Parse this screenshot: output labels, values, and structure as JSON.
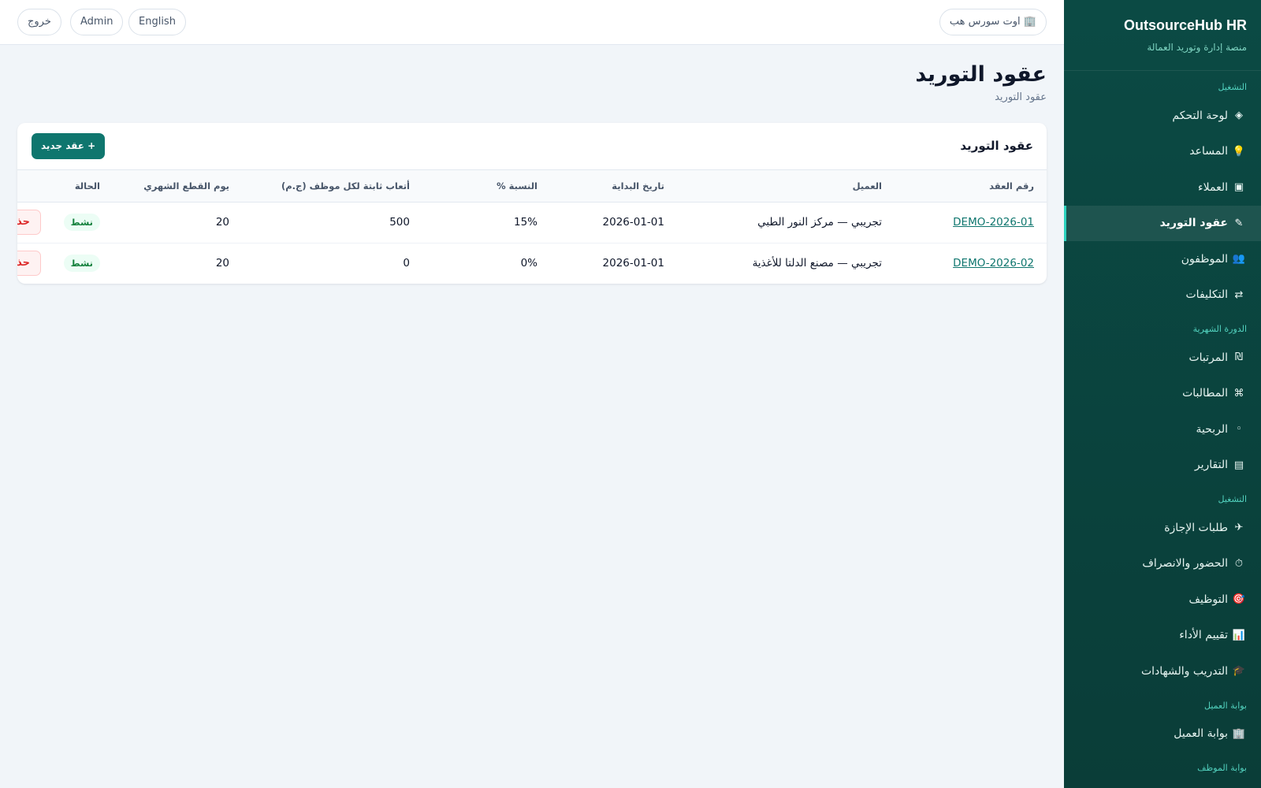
{
  "brand": {
    "title": "OutsourceHub HR",
    "subtitle": "منصة إدارة وتوريد العمالة"
  },
  "sidebar": {
    "sections": [
      {
        "label": "التشغيل",
        "items": [
          {
            "icon": "◈",
            "label": "لوحة التحكم"
          },
          {
            "icon": "💡",
            "label": "المساعد"
          },
          {
            "icon": "▣",
            "label": "العملاء"
          },
          {
            "icon": "✎",
            "label": "عقود التوريد",
            "active": true
          },
          {
            "icon": "👥",
            "label": "الموظفون"
          },
          {
            "icon": "⇄",
            "label": "التكليفات"
          }
        ]
      },
      {
        "label": "الدورة الشهرية",
        "items": [
          {
            "icon": "₪",
            "label": "المرتبات"
          },
          {
            "icon": "⌘",
            "label": "المطالبات"
          },
          {
            "icon": "◦",
            "label": "الربحية"
          },
          {
            "icon": "▤",
            "label": "التقارير"
          }
        ]
      },
      {
        "label": "التشغيل",
        "items": [
          {
            "icon": "✈",
            "label": "طلبات الإجازة"
          },
          {
            "icon": "⏱",
            "label": "الحضور والانصراف"
          },
          {
            "icon": "🎯",
            "label": "التوظيف"
          },
          {
            "icon": "📊",
            "label": "تقييم الأداء"
          },
          {
            "icon": "🎓",
            "label": "التدريب والشهادات"
          }
        ]
      },
      {
        "label": "بوابة العميل",
        "items": [
          {
            "icon": "🏢",
            "label": "بوابة العميل"
          }
        ]
      },
      {
        "label": "بوابة الموظف",
        "items": []
      }
    ]
  },
  "topbar": {
    "org_icon": "🏢",
    "org_label": "اوت سورس هب",
    "language": "English",
    "user": "Admin",
    "logout": "خروج"
  },
  "page": {
    "title": "عقود التوريد",
    "breadcrumb": "عقود التوريد"
  },
  "card": {
    "title": "عقود التوريد",
    "new_button": "+ عقد جديد"
  },
  "table": {
    "columns": [
      "رقم العقد",
      "العميل",
      "تاريخ البداية",
      "النسبة %",
      "أتعاب ثابتة لكل موظف (ج.م)",
      "يوم القطع الشهري",
      "الحالة",
      ""
    ],
    "rows": [
      {
        "contract_no": "DEMO-2026-01",
        "client": "تجريبي — مركز النور الطبي",
        "start_date": "2026-01-01",
        "percent": "15%",
        "fixed_fee": "500",
        "cutoff_day": "20",
        "status": "نشط",
        "delete": "حذف"
      },
      {
        "contract_no": "DEMO-2026-02",
        "client": "تجريبي — مصنع الدلتا للأغذية",
        "start_date": "2026-01-01",
        "percent": "0%",
        "fixed_fee": "0",
        "cutoff_day": "20",
        "status": "نشط",
        "delete": "حذف"
      }
    ]
  },
  "colors": {
    "sidebar_bg": "#0b4a44",
    "accent": "#0f766e",
    "active_indicator": "#2dd4bf",
    "status_active": "#15803d",
    "danger": "#dc2626"
  }
}
